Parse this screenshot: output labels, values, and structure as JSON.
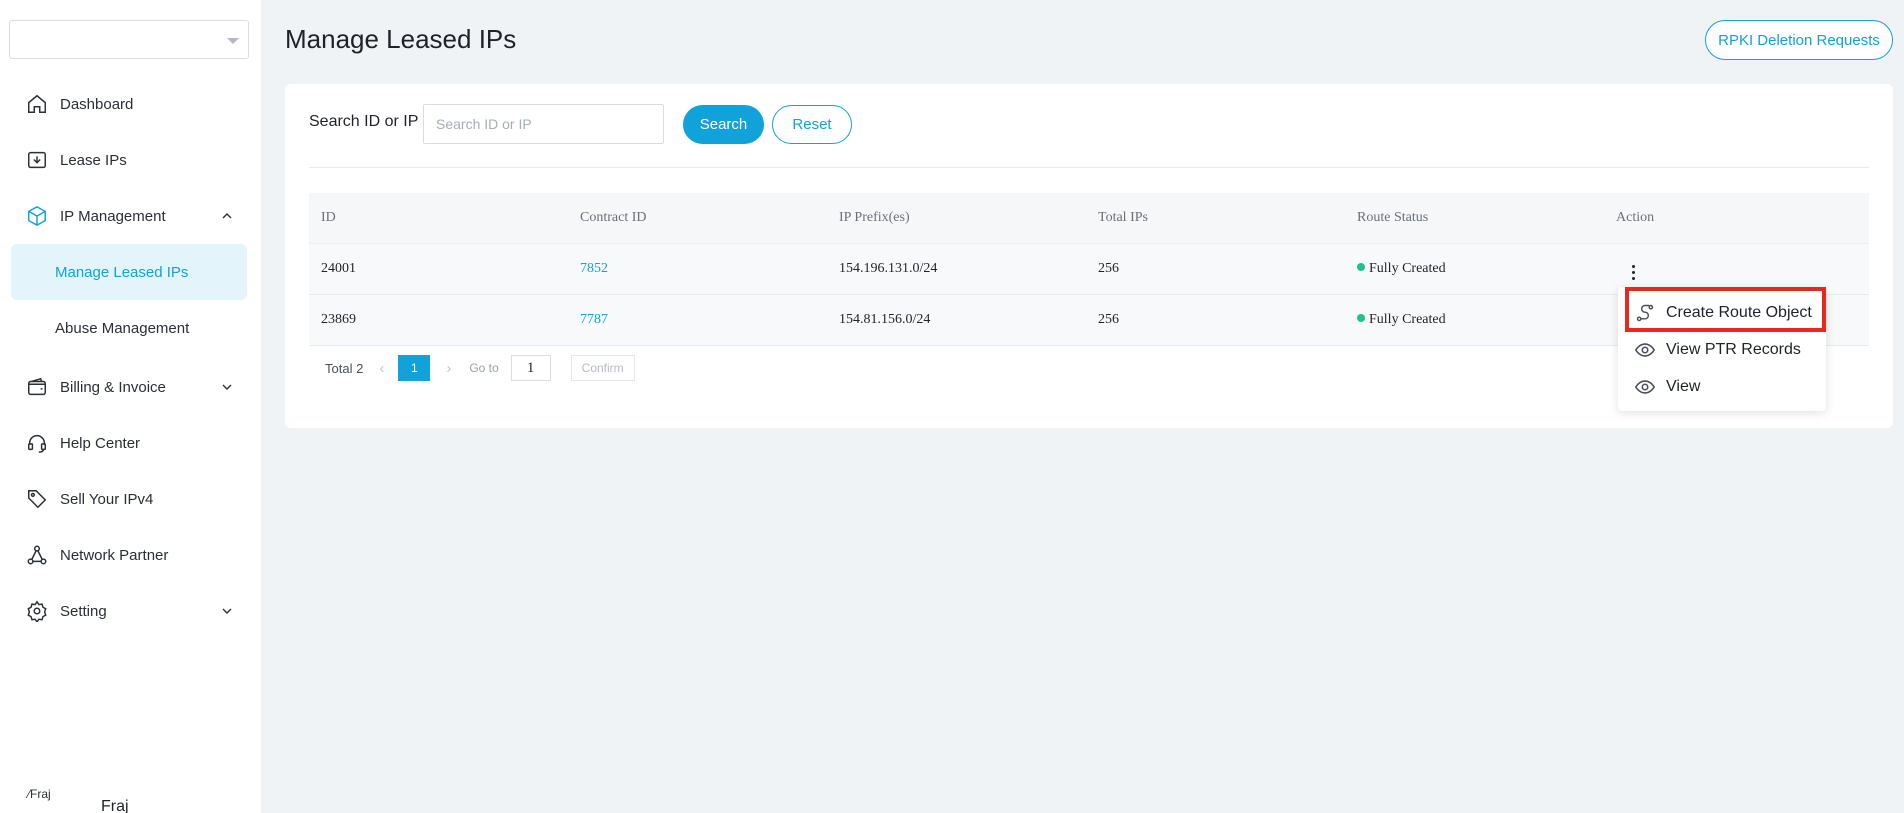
{
  "sidebar": {
    "org_select_value": "",
    "items": [
      {
        "label": "Dashboard"
      },
      {
        "label": "Lease IPs"
      },
      {
        "label": "IP Management"
      },
      {
        "label": "Manage Leased IPs"
      },
      {
        "label": "Abuse Management"
      },
      {
        "label": "Billing & Invoice"
      },
      {
        "label": "Help Center"
      },
      {
        "label": "Sell Your IPv4"
      },
      {
        "label": "Network Partner"
      },
      {
        "label": "Setting"
      }
    ],
    "user_image_alt": "Fraj",
    "user_name": "Fraj"
  },
  "header": {
    "title": "Manage Leased IPs",
    "rpki_button": "RPKI Deletion Requests"
  },
  "search": {
    "label": "Search ID or IP",
    "placeholder": "Search ID or IP",
    "value": "",
    "search_button": "Search",
    "reset_button": "Reset"
  },
  "table": {
    "columns": [
      "ID",
      "Contract ID",
      "IP Prefix(es)",
      "Total IPs",
      "Route Status",
      "Action"
    ],
    "rows": [
      {
        "id": "24001",
        "contract_id": "7852",
        "prefix": "154.196.131.0/24",
        "total": "256",
        "status": "Fully Created"
      },
      {
        "id": "23869",
        "contract_id": "7787",
        "prefix": "154.81.156.0/24",
        "total": "256",
        "status": "Fully Created"
      }
    ]
  },
  "pagination": {
    "total": "Total 2",
    "current_page": "1",
    "goto_label": "Go to",
    "goto_value": "1",
    "confirm": "Confirm"
  },
  "action_menu": {
    "items": [
      {
        "label": "Create Route Object",
        "icon": "route-icon"
      },
      {
        "label": "View PTR Records",
        "icon": "eye-icon"
      },
      {
        "label": "View",
        "icon": "eye-icon"
      }
    ]
  },
  "colors": {
    "accent": "#10a2d8",
    "status_green": "#1cc48a",
    "highlight_red": "#e8281f"
  }
}
